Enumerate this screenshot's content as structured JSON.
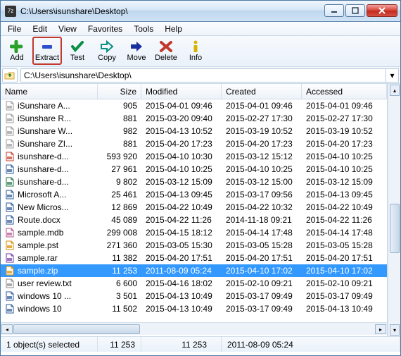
{
  "window": {
    "title": "C:\\Users\\isunshare\\Desktop\\"
  },
  "menu": [
    "File",
    "Edit",
    "View",
    "Favorites",
    "Tools",
    "Help"
  ],
  "toolbar": [
    {
      "id": "add",
      "label": "Add",
      "icon": "plus",
      "color": "#2aa12a"
    },
    {
      "id": "extract",
      "label": "Extract",
      "icon": "minus",
      "color": "#2b4fcf",
      "highlight": true
    },
    {
      "id": "test",
      "label": "Test",
      "icon": "check",
      "color": "#0a8f45"
    },
    {
      "id": "copy",
      "label": "Copy",
      "icon": "arrow-right-hollow",
      "color": "#0a8f80"
    },
    {
      "id": "move",
      "label": "Move",
      "icon": "arrow-right",
      "color": "#1630a0"
    },
    {
      "id": "delete",
      "label": "Delete",
      "icon": "x",
      "color": "#c0392b"
    },
    {
      "id": "info",
      "label": "Info",
      "icon": "i",
      "color": "#d6b400"
    }
  ],
  "path": {
    "value": "C:\\Users\\isunshare\\Desktop\\"
  },
  "columns": {
    "name": "Name",
    "size": "Size",
    "modified": "Modified",
    "created": "Created",
    "accessed": "Accessed"
  },
  "rows": [
    {
      "icon": "file",
      "name": "iSunshare A...",
      "size": "905",
      "mod": "2015-04-01 09:46",
      "crt": "2015-04-01 09:46",
      "acc": "2015-04-01 09:46"
    },
    {
      "icon": "file",
      "name": "iSunshare R...",
      "size": "881",
      "mod": "2015-03-20 09:40",
      "crt": "2015-02-27 17:30",
      "acc": "2015-02-27 17:30"
    },
    {
      "icon": "file",
      "name": "iSunshare W...",
      "size": "982",
      "mod": "2015-04-13 10:52",
      "crt": "2015-03-19 10:52",
      "acc": "2015-03-19 10:52"
    },
    {
      "icon": "file",
      "name": "iSunshare ZI...",
      "size": "881",
      "mod": "2015-04-20 17:23",
      "crt": "2015-04-20 17:23",
      "acc": "2015-04-20 17:23"
    },
    {
      "icon": "pdf",
      "name": "isunshare-d...",
      "size": "593 920",
      "mod": "2015-04-10 10:30",
      "crt": "2015-03-12 15:12",
      "acc": "2015-04-10 10:25"
    },
    {
      "icon": "doc",
      "name": "isunshare-d...",
      "size": "27 961",
      "mod": "2015-04-10 10:25",
      "crt": "2015-04-10 10:25",
      "acc": "2015-04-10 10:25"
    },
    {
      "icon": "xls",
      "name": "isunshare-d...",
      "size": "9 802",
      "mod": "2015-03-12 15:09",
      "crt": "2015-03-12 15:00",
      "acc": "2015-03-12 15:09"
    },
    {
      "icon": "doc",
      "name": "Microsoft A...",
      "size": "25 461",
      "mod": "2015-04-13 09:45",
      "crt": "2015-03-17 09:56",
      "acc": "2015-04-13 09:45"
    },
    {
      "icon": "doc",
      "name": "New Micros...",
      "size": "12 869",
      "mod": "2015-04-22 10:49",
      "crt": "2015-04-22 10:32",
      "acc": "2015-04-22 10:49"
    },
    {
      "icon": "doc",
      "name": "Route.docx",
      "size": "45 089",
      "mod": "2015-04-22 11:26",
      "crt": "2014-11-18 09:21",
      "acc": "2015-04-22 11:26"
    },
    {
      "icon": "mdb",
      "name": "sample.mdb",
      "size": "299 008",
      "mod": "2015-04-15 18:12",
      "crt": "2015-04-14 17:48",
      "acc": "2015-04-14 17:48"
    },
    {
      "icon": "pst",
      "name": "sample.pst",
      "size": "271 360",
      "mod": "2015-03-05 15:30",
      "crt": "2015-03-05 15:28",
      "acc": "2015-03-05 15:28"
    },
    {
      "icon": "rar",
      "name": "sample.rar",
      "size": "11 382",
      "mod": "2015-04-20 17:51",
      "crt": "2015-04-20 17:51",
      "acc": "2015-04-20 17:51"
    },
    {
      "icon": "zip",
      "name": "sample.zip",
      "size": "11 253",
      "mod": "2011-08-09 05:24",
      "crt": "2015-04-10 17:02",
      "acc": "2015-04-10 17:02",
      "selected": true
    },
    {
      "icon": "txt",
      "name": "user review.txt",
      "size": "6 600",
      "mod": "2015-04-16 18:02",
      "crt": "2015-02-10 09:21",
      "acc": "2015-02-10 09:21"
    },
    {
      "icon": "doc",
      "name": "windows 10 ...",
      "size": "3 501",
      "mod": "2015-04-13 10:49",
      "crt": "2015-03-17 09:49",
      "acc": "2015-03-17 09:49"
    },
    {
      "icon": "doc",
      "name": "windows 10",
      "size": "11 502",
      "mod": "2015-04-13 10:49",
      "crt": "2015-03-17 09:49",
      "acc": "2015-04-13 10:49"
    }
  ],
  "status": {
    "selection": "1 object(s) selected",
    "size1": "11 253",
    "size2": "11 253",
    "date": "2011-08-09 05:24"
  }
}
